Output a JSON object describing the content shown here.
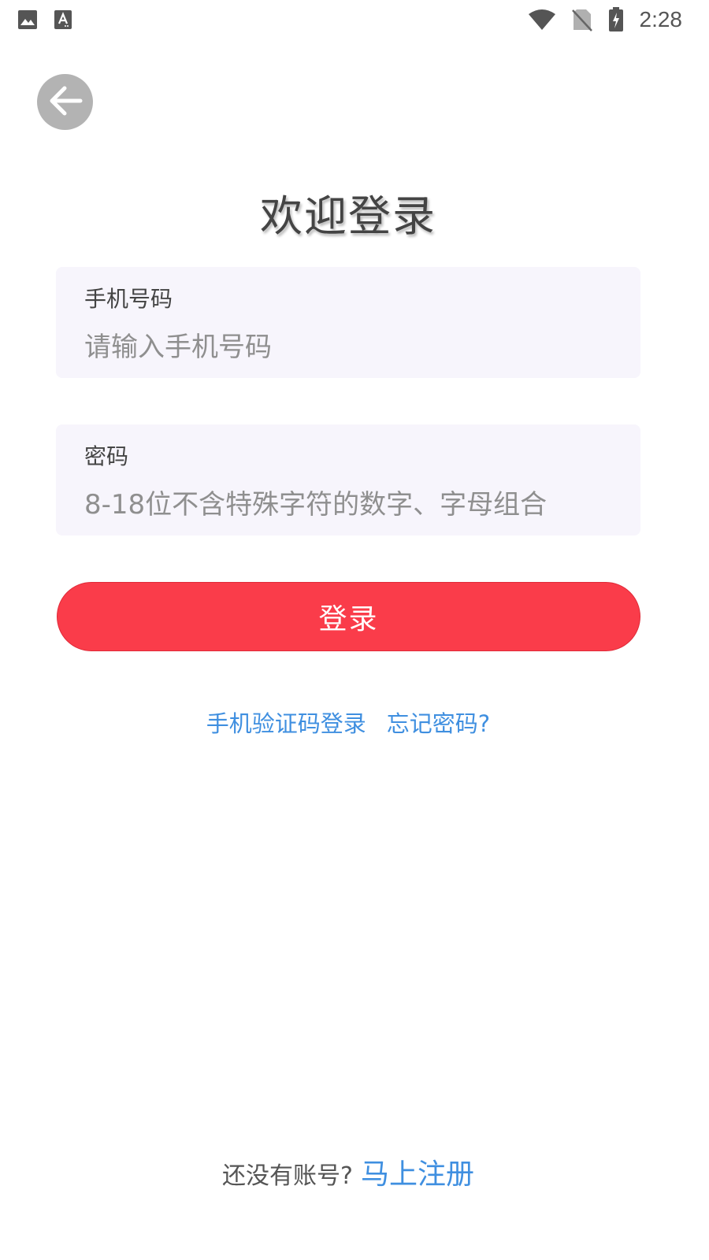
{
  "status_bar": {
    "time": "2:28",
    "left_icons": [
      "image-icon",
      "text-a-icon"
    ],
    "right_icons": [
      "wifi-icon",
      "no-sim-icon",
      "battery-charging-icon"
    ]
  },
  "back_button": {
    "icon": "arrow-left-icon"
  },
  "title": "欢迎登录",
  "phone_field": {
    "label": "手机号码",
    "value": "",
    "placeholder": "请输入手机号码"
  },
  "password_field": {
    "label": "密码",
    "value": "",
    "placeholder": "8-18位不含特殊字符的数字、字母组合"
  },
  "login_button": {
    "label": "登录",
    "color": "#fa3c4a"
  },
  "links": {
    "sms_login": "手机验证码登录",
    "forgot_password": "忘记密码?"
  },
  "footer": {
    "prompt": "还没有账号?",
    "register": "马上注册"
  },
  "colors": {
    "link": "#3f8fe0",
    "field_bg": "#f7f5fc"
  }
}
